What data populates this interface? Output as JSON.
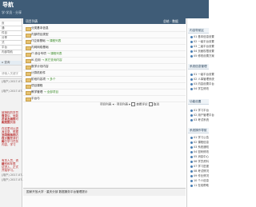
{
  "header": {
    "title": "导航",
    "subtitle": "学·学员 · 分享"
  },
  "left": {
    "menu": [
      "页",
      "通",
      "件目",
      "分享",
      "式",
      "平台",
      "内部导航"
    ],
    "search_label": "⌂ 查询",
    "input_placeholder": "请输入关键字",
    "chat": [
      {
        "name": "(用户) 2017-07-29 10:17:11",
        "text": ""
      },
      {
        "name": "(用户) 2017-07-29 10:17:22",
        "text": ""
      },
      {
        "name": "",
        "text": "被授权的学员自己"
      },
      {
        "name": "",
        "text": "登录后，就能看到上级的可用范围"
      },
      {
        "name": "",
        "text": "，以及列表 2、"
      },
      {
        "name": "",
        "text": "相关的页面"
      },
      {
        "name": "",
        "text": "在这里可以进入"
      },
      {
        "name": "",
        "text": "对目录，根据不同的情况，在页面"
      },
      {
        "name": "",
        "text": "当中展示的内"
      },
      {
        "name": "",
        "text": "容，就是我们的"
      },
      {
        "name": "",
        "text": "每日学习任务"
      },
      {
        "name": "",
        "text": "内容，学习"
      },
      {
        "name": "",
        "text": "有关人员，资格"
      },
      {
        "name": "",
        "text": "级别和年限"
      },
      {
        "name": "",
        "text": "证进入，正式"
      },
      {
        "name": "",
        "text": "开始学习。"
      },
      {
        "name": "(用户) 2017-07-29 10:17:32",
        "text": ""
      },
      {
        "name": "(用户) 2017-07-29 10:17:42",
        "text": ""
      }
    ]
  },
  "main": {
    "header_left": "项目列表",
    "header_right": "总结 · 数据",
    "rows": [
      {
        "name": "分类基本信息",
        "sub": ""
      },
      {
        "name": "内部项目类型",
        "sub": ""
      },
      {
        "name": "IT应用基础",
        "sub": "→ 课程列表"
      },
      {
        "name": "内网网络基础",
        "sub": ""
      },
      {
        "name": "IT 综合专项",
        "sub": "→ 课程列表"
      },
      {
        "name": "IK 应用",
        "sub": "→ 其它查询内容"
      },
      {
        "name": "数学计划内容",
        "sub": ""
      },
      {
        "name": "计算机软件",
        "sub": ""
      },
      {
        "name": "阶段内容项",
        "sub": "→ 多个"
      },
      {
        "name": "项目课程",
        "sub": ""
      },
      {
        "name": "教学管理",
        "sub": "→ 全部项目"
      },
      {
        "name": "平台与",
        "sub": ""
      }
    ],
    "pager": {
      "prev": "项目列表",
      "next": "项目列表",
      "refresh": "查看评论",
      "close": "取消"
    },
    "status": "国家开放大学 · 重庆分部 数据服务平台管理提示"
  },
  "right": {
    "sections": [
      {
        "title": "内容导航区",
        "items": [
          "01 基本信息设置",
          "02 一级平台设置",
          "03 二级平台设置",
          "04 页面权限设置",
          "05 修改设置方案"
        ]
      },
      {
        "title": "系统信息管理",
        "items": [
          "01 一级平台设置",
          "02 人事管理系统",
          "03 内容设置平台",
          "04 学生修改"
        ]
      },
      {
        "title": "功能设置",
        "items": [
          "01 学习平台",
          "02 用户管理平台",
          "03 考试系统"
        ]
      },
      {
        "title": "系统操作导航",
        "items": [
          "01 学习公告",
          "02 课程信息",
          "03 系统通知",
          "04 密码修改",
          "05 消息中心",
          "06 学员资料",
          "07 学习进度",
          "08 考试情况",
          "09 作业情况",
          "10 个人信息",
          "11 在线帮助"
        ]
      }
    ]
  }
}
